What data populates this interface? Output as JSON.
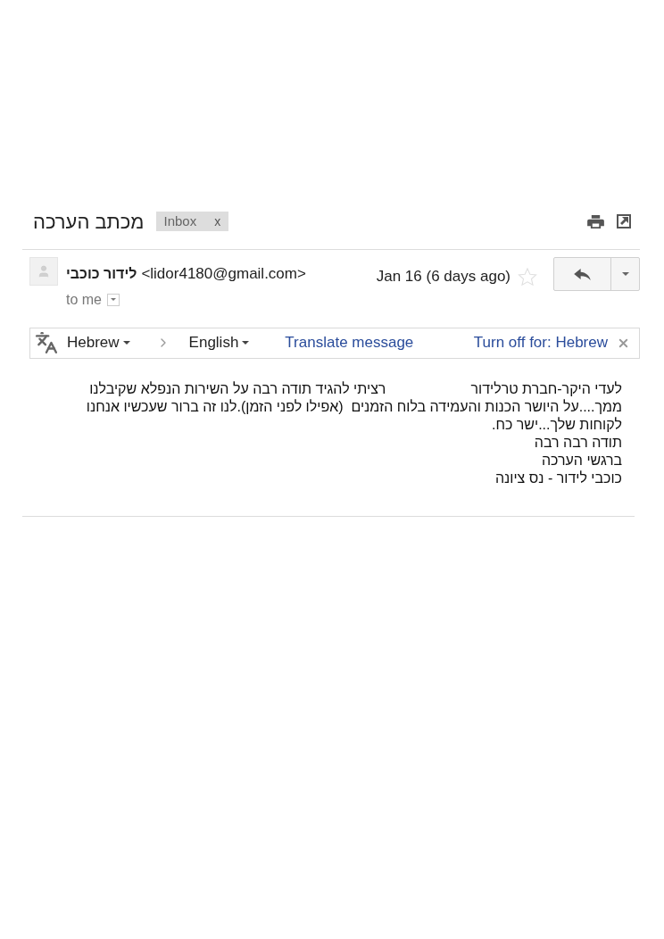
{
  "email": {
    "subject": "מכתב הערכה",
    "labels": [
      {
        "name": "Inbox",
        "remove": "x"
      }
    ]
  },
  "message": {
    "sender_name": "לידור כוכבי",
    "sender_email": "<lidor4180@gmail.com>",
    "date": "Jan 16 (6 days ago)",
    "starred": false,
    "recipient": "to me"
  },
  "translate_bar": {
    "source_language": "Hebrew",
    "target_language": "English",
    "translate_link": "Translate message",
    "turn_off_link": "Turn off for: Hebrew"
  },
  "body": {
    "lines": [
      [
        "לעדי היקר-חברת טרלידור",
        "רציתי להגיד תודה רבה על השירות הנפלא שקיבלנו"
      ],
      [
        "ממך....על היושר הכנות והעמידה בלוח הזמנים  (אפילו לפני הזמן).לנו זה ברור שעכשיו אנחנו"
      ],
      [
        "לקוחות שלך...ישר כח."
      ],
      [
        "תודה רבה רבה"
      ],
      [
        "ברגשי הערכה"
      ],
      [
        "כוכבי לידור - נס ציונה"
      ]
    ]
  }
}
